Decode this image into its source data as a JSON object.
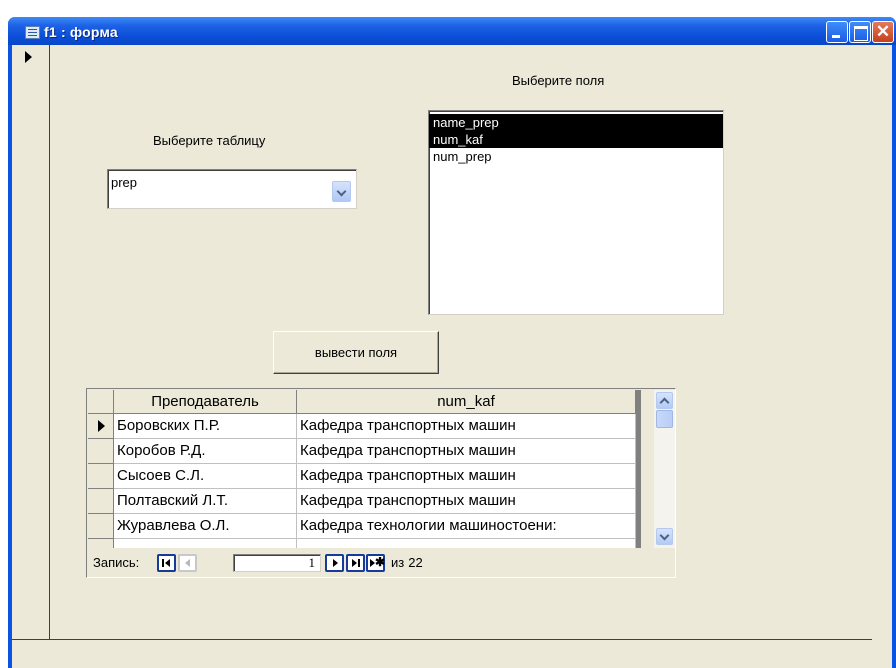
{
  "window": {
    "title": "f1 : форма",
    "close_glyph": "✕",
    "icon": "form-icon"
  },
  "form": {
    "fields_label": "Выберите поля",
    "table_label": "Выберите таблицу",
    "table_combo": {
      "value": "prep"
    },
    "fields_list": [
      {
        "label": "name_prep",
        "selected": true
      },
      {
        "label": "num_kaf",
        "selected": true
      },
      {
        "label": "num_prep",
        "selected": false
      }
    ],
    "show_button_label": "вывести поля"
  },
  "grid": {
    "headers": [
      "Преподаватель",
      "num_kaf"
    ],
    "rows": [
      {
        "c1": "Боровских П.Р.",
        "c2": "Кафедра транспортных машин",
        "current": true
      },
      {
        "c1": "Коробов Р.Д.",
        "c2": "Кафедра транспортных машин",
        "current": false
      },
      {
        "c1": "Сысоев С.Л.",
        "c2": "Кафедра транспортных машин",
        "current": false
      },
      {
        "c1": "Полтавский Л.Т.",
        "c2": "Кафедра транспортных машин",
        "current": false
      },
      {
        "c1": "Журавлева О.Л.",
        "c2": "Кафедра технологии машиностоени:",
        "current": false
      }
    ]
  },
  "navigation": {
    "record_label": "Запись:",
    "current_record": "1",
    "of_label": "из",
    "total_records": "22",
    "new_glyph": "✱"
  },
  "colors": {
    "titlebar": "#0b4fd8",
    "form_background": "#ece9d8",
    "selection": "#000000"
  }
}
